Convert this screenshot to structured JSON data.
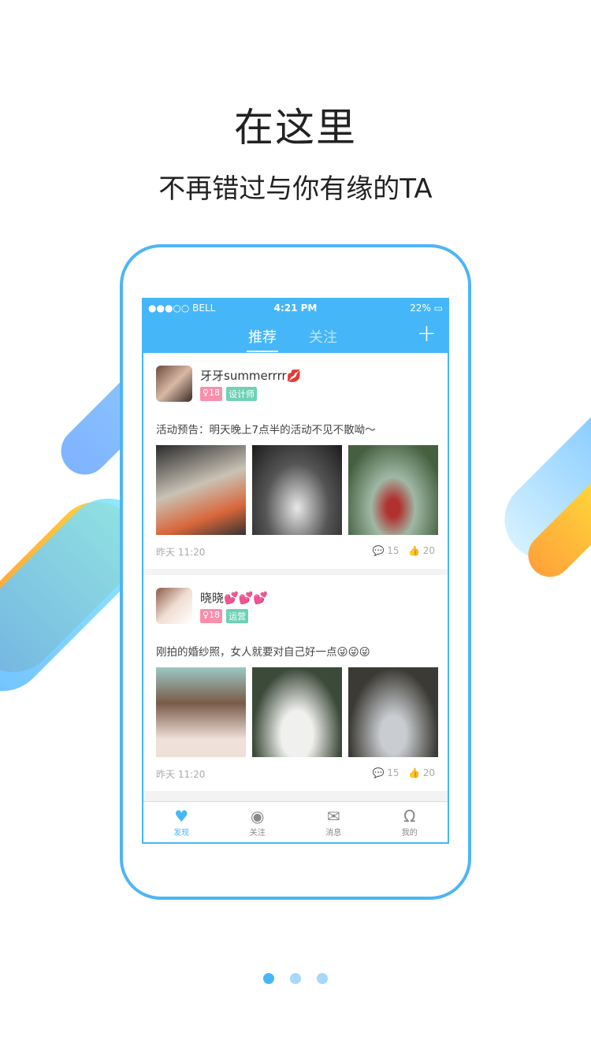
{
  "headline": "在这里",
  "subheadline": "不再错过与你有缘的TA",
  "status": {
    "carrier": "●●●○○ BELL",
    "time": "4:21 PM",
    "battery": "22%"
  },
  "nav": {
    "tabs": [
      "推荐",
      "关注"
    ],
    "plus": "+"
  },
  "posts": [
    {
      "name": "牙牙summerrrr",
      "emoji": "💋",
      "age": "♀18",
      "role": "设计师",
      "text": "活动预告：明天晚上7点半的活动不见不散呦～",
      "time": "昨天 11:20",
      "comments": "15",
      "likes": "20"
    },
    {
      "name": "晓晓",
      "emoji": "💕💕💕",
      "age": "♀18",
      "role": "运营",
      "text": "刚拍的婚纱照，女人就要对自己好一点😜😜😜",
      "time": "昨天 11:20",
      "comments": "15",
      "likes": "20"
    }
  ],
  "tabbar": [
    {
      "label": "发现",
      "icon": "heart-icon"
    },
    {
      "label": "关注",
      "icon": "eye-icon"
    },
    {
      "label": "消息",
      "icon": "mail-icon"
    },
    {
      "label": "我的",
      "icon": "user-icon"
    }
  ],
  "pager": {
    "pages": 3,
    "current": 1
  }
}
